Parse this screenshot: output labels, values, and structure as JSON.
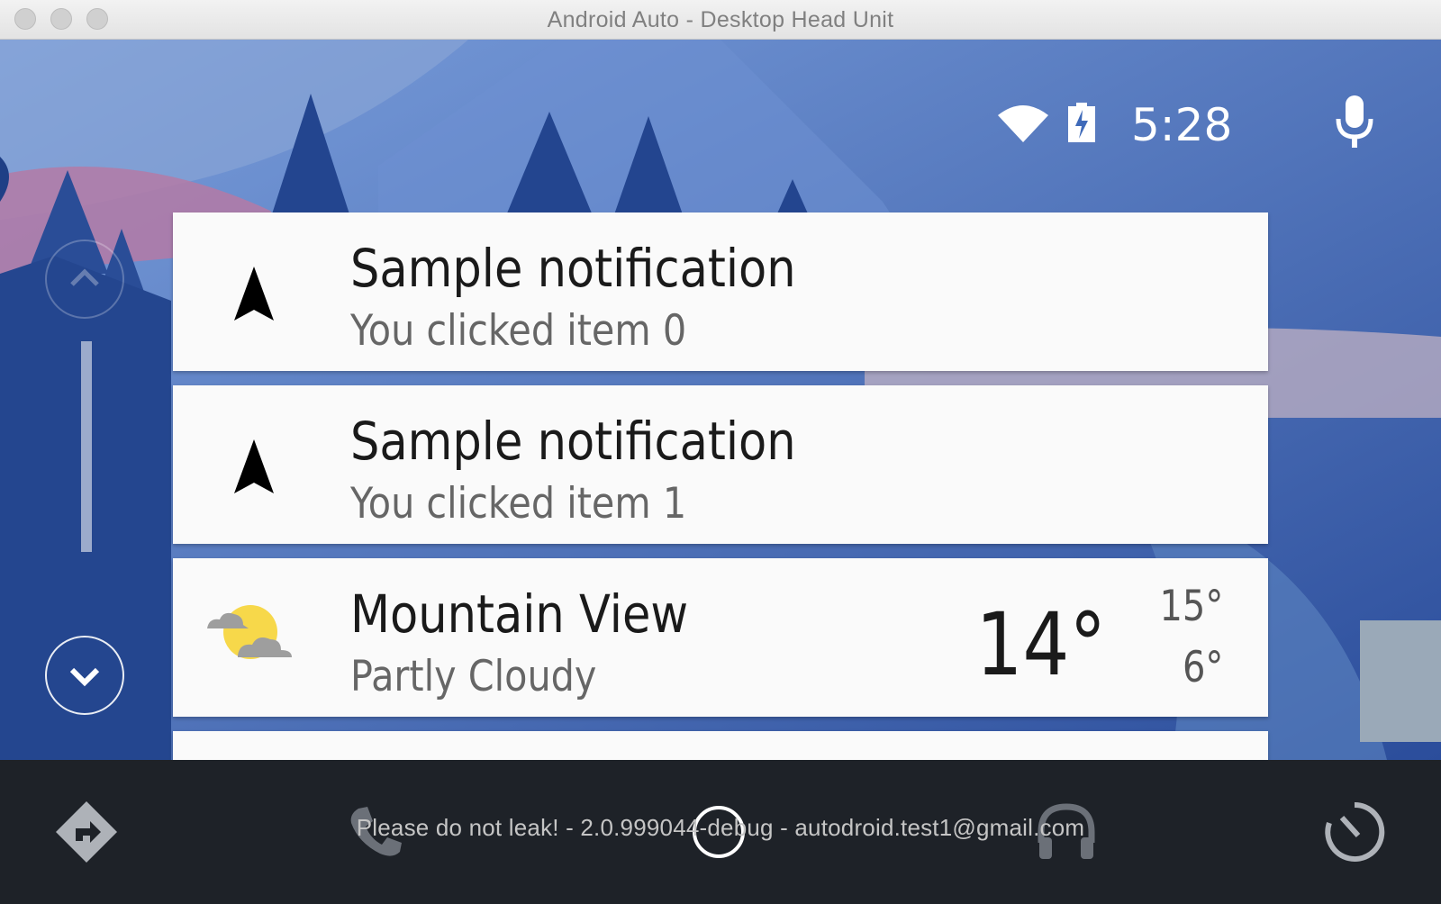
{
  "window": {
    "title": "Android Auto - Desktop Head Unit"
  },
  "status_bar": {
    "time": "5:28",
    "icons": [
      "wifi-icon",
      "battery-charging-icon",
      "microphone-icon"
    ]
  },
  "notifications": [
    {
      "icon": "navigation-arrow-icon",
      "title": "Sample notification",
      "subtitle": "You clicked item 0"
    },
    {
      "icon": "navigation-arrow-icon",
      "title": "Sample notification",
      "subtitle": "You clicked item 1"
    }
  ],
  "weather": {
    "icon": "partly-cloudy-icon",
    "location": "Mountain View",
    "condition": "Partly Cloudy",
    "current_temp": "14°",
    "high_temp": "15°",
    "low_temp": "6°"
  },
  "scroll": {
    "up_icon": "chevron-up-icon",
    "down_icon": "chevron-down-icon"
  },
  "navbar": {
    "items": [
      "navigation-icon",
      "phone-icon",
      "home-icon",
      "headphones-icon",
      "exit-dashboard-icon"
    ],
    "watermark": "Please do not leak! - 2.0.999044-debug - autodroid.test1@gmail.com"
  },
  "colors": {
    "card_bg": "#fafafa",
    "navbar_bg": "#1e2228",
    "wallpaper_primary": "#3f6ab9"
  }
}
